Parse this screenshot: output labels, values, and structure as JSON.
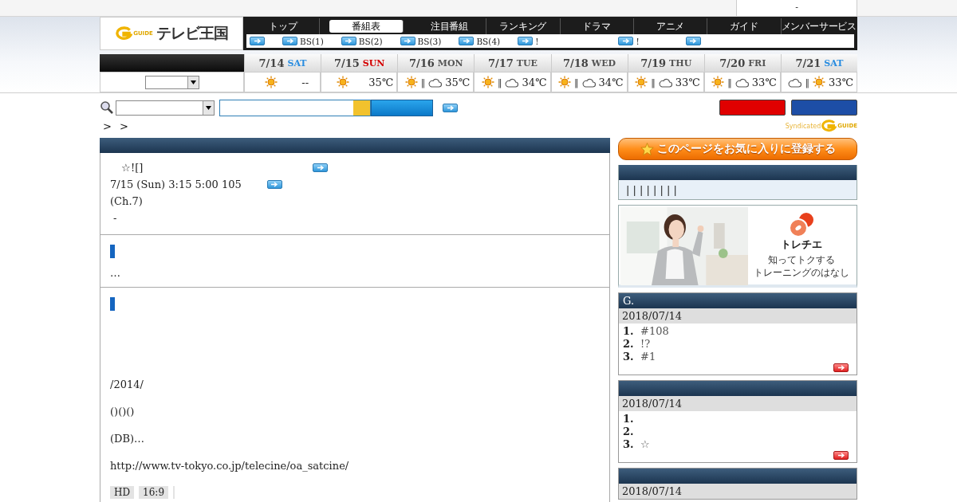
{
  "top_bar": {
    "text": "-"
  },
  "logo": {
    "badge": "GUIDE",
    "title": "テレビ王国"
  },
  "nav": {
    "tabs": [
      {
        "label": "トップ",
        "selected": false
      },
      {
        "label": "番組表",
        "selected": true
      },
      {
        "label": "注目番組",
        "selected": false
      },
      {
        "label": "ランキング",
        "selected": false
      },
      {
        "label": "ドラマ",
        "selected": false
      },
      {
        "label": "アニメ",
        "selected": false
      },
      {
        "label": "ガイド",
        "selected": false
      },
      {
        "label": "メンバーサービス",
        "selected": false
      }
    ],
    "links": [
      {
        "kind": "arrow"
      },
      {
        "kind": "labeled",
        "label": "BS(1)"
      },
      {
        "kind": "labeled",
        "label": "BS(2)"
      },
      {
        "kind": "labeled",
        "label": "BS(3)"
      },
      {
        "kind": "labeled",
        "label": "BS(4)"
      },
      {
        "kind": "labeled",
        "label": "!"
      },
      {
        "kind": "labeled",
        "label": "!"
      },
      {
        "kind": "arrow"
      }
    ]
  },
  "days": [
    {
      "date": "7/14",
      "dow": "SAT",
      "color": "#2a8de0",
      "weather": [
        {
          "kind": "sun"
        }
      ],
      "temp": "--"
    },
    {
      "date": "7/15",
      "dow": "SUN",
      "color": "#d40000",
      "weather": [
        {
          "kind": "sun"
        }
      ],
      "temp": "35℃"
    },
    {
      "date": "7/16",
      "dow": "MON",
      "color": "#555555",
      "weather": [
        {
          "kind": "sun"
        },
        {
          "kind": "separator",
          "text": "‖"
        },
        {
          "kind": "cloud"
        }
      ],
      "temp": "35℃"
    },
    {
      "date": "7/17",
      "dow": "TUE",
      "color": "#555555",
      "weather": [
        {
          "kind": "sun"
        },
        {
          "kind": "separator",
          "text": "‖"
        },
        {
          "kind": "cloud"
        }
      ],
      "temp": "34℃"
    },
    {
      "date": "7/18",
      "dow": "WED",
      "color": "#555555",
      "weather": [
        {
          "kind": "sun"
        },
        {
          "kind": "separator",
          "text": "‖"
        },
        {
          "kind": "cloud"
        }
      ],
      "temp": "34℃"
    },
    {
      "date": "7/19",
      "dow": "THU",
      "color": "#555555",
      "weather": [
        {
          "kind": "sun"
        },
        {
          "kind": "separator",
          "text": "‖"
        },
        {
          "kind": "cloud"
        }
      ],
      "temp": "33℃"
    },
    {
      "date": "7/20",
      "dow": "FRI",
      "color": "#555555",
      "weather": [
        {
          "kind": "sun"
        },
        {
          "kind": "separator",
          "text": "‖"
        },
        {
          "kind": "cloud"
        }
      ],
      "temp": "33℃"
    },
    {
      "date": "7/21",
      "dow": "SAT",
      "color": "#2a8de0",
      "weather": [
        {
          "kind": "cloud"
        },
        {
          "kind": "separator",
          "text": "‖"
        },
        {
          "kind": "sun"
        }
      ],
      "temp": "33℃"
    }
  ],
  "search": {
    "buttons": [
      {
        "color": "#e00000"
      },
      {
        "color": "#1d4ea6"
      }
    ]
  },
  "breadcrumb": [
    ">",
    ">"
  ],
  "syndicated": {
    "text": "Syndicated",
    "badge": "GUIDE"
  },
  "program": {
    "title": "☆![]",
    "schedule": "7/15 (Sun) 3:15  5:00 105",
    "channel": "(Ch.7)",
    "note": "-"
  },
  "sections": [
    {
      "lines": [
        "…"
      ]
    },
    {
      "lines": [
        "/2014/",
        "()()()",
        "(DB)…",
        "http://www.tv-tokyo.co.jp/telecine/oa_satcine/"
      ],
      "tags": [
        {
          "kind": "text",
          "label": "HD"
        },
        {
          "kind": "text",
          "label": "16:9"
        },
        {
          "kind": "blank"
        }
      ]
    }
  ],
  "sidebar": {
    "favorite_button": "このページをお気に入りに登録する",
    "genre_bar": "| | | | | | | |",
    "ad": {
      "brand": "トレチエ",
      "lines": [
        "知ってトクする",
        "トレーニングのはなし"
      ]
    },
    "rankings": [
      {
        "title": "G.",
        "date": "2018/07/14",
        "items": [
          {
            "rank": "1.",
            "title": "#108"
          },
          {
            "rank": "2.",
            "title": "!?"
          },
          {
            "rank": "3.",
            "title": "#1"
          }
        ]
      },
      {
        "date": "2018/07/14",
        "items": [
          {
            "rank": "1."
          },
          {
            "rank": "2."
          },
          {
            "rank": "3.",
            "title": "☆"
          }
        ]
      },
      {
        "date": "2018/07/14"
      }
    ]
  }
}
